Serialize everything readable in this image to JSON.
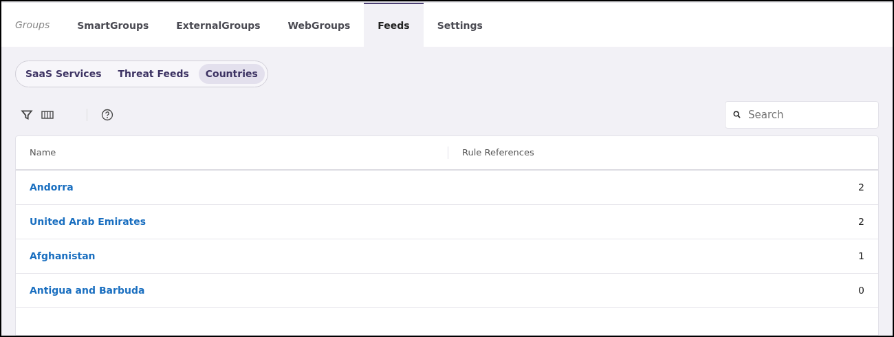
{
  "nav": {
    "label": "Groups",
    "tabs": [
      {
        "label": "SmartGroups",
        "selected": false
      },
      {
        "label": "ExternalGroups",
        "selected": false
      },
      {
        "label": "WebGroups",
        "selected": false
      },
      {
        "label": "Feeds",
        "selected": true
      },
      {
        "label": "Settings",
        "selected": false
      }
    ]
  },
  "segments": [
    {
      "label": "SaaS Services",
      "selected": false
    },
    {
      "label": "Threat Feeds",
      "selected": false
    },
    {
      "label": "Countries",
      "selected": true
    }
  ],
  "search": {
    "placeholder": "Search"
  },
  "table": {
    "columns": [
      "Name",
      "Rule References"
    ],
    "rows": [
      {
        "name": "Andorra",
        "references": "2"
      },
      {
        "name": "United Arab Emirates",
        "references": "2"
      },
      {
        "name": "Afghanistan",
        "references": "1"
      },
      {
        "name": "Antigua and Barbuda",
        "references": "0"
      }
    ]
  }
}
